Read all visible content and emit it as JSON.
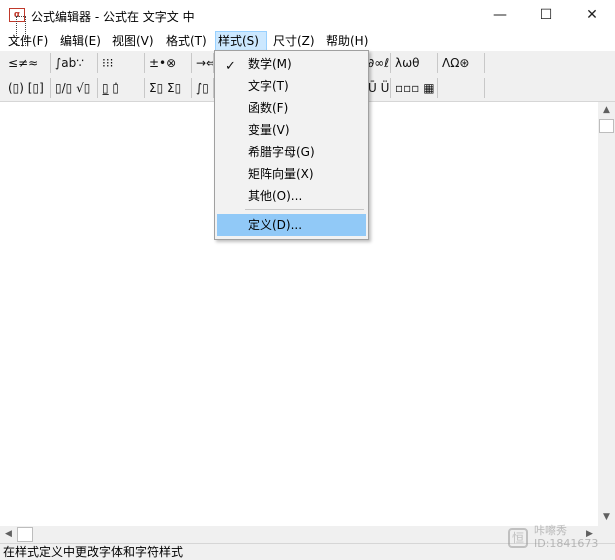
{
  "window": {
    "icon_letter": "α",
    "title": "公式编辑器 - 公式在 文字文 中",
    "controls": [
      "—",
      "☐",
      "✕"
    ]
  },
  "menubar": [
    {
      "label": "文件(F)"
    },
    {
      "label": "编辑(E)"
    },
    {
      "label": "视图(V)"
    },
    {
      "label": "格式(T)"
    },
    {
      "label": "样式(S)"
    },
    {
      "label": "尺寸(Z)"
    },
    {
      "label": "帮助(H)"
    }
  ],
  "toolbar": {
    "row1": [
      "≤≠≈",
      "∫ab∵",
      "⁝⁝⁝",
      "±•⊗",
      "→⇔↓",
      "∴∀∃",
      "∉∩⊂",
      "∂∞ℓ",
      "λωθ",
      "ΛΩ⊛"
    ],
    "row2": [
      "(▯) [▯]",
      "▯/▯ √▯",
      "▯̲ ▯̇",
      "Σ▯ Σ▯",
      "∫▯ ∮▯",
      "",
      "",
      "Ū Ü",
      "▫▫▫ ▦",
      ""
    ]
  },
  "dropdown": {
    "items": [
      {
        "label": "数学(M)",
        "checked": true
      },
      {
        "label": "文字(T)"
      },
      {
        "label": "函数(F)"
      },
      {
        "label": "变量(V)"
      },
      {
        "label": "希腊字母(G)"
      },
      {
        "label": "矩阵向量(X)"
      },
      {
        "label": "其他(O)..."
      }
    ],
    "define_item": {
      "label": "定义(D)...",
      "highlighted": true
    },
    "check_mark": "✓"
  },
  "scrollbars": {
    "up_arrow": "▲",
    "down_arrow": "▼",
    "left_arrow": "◀",
    "right_arrow": "▶"
  },
  "status": {
    "text": "在样式定义中更改字体和字符样式"
  },
  "watermark": {
    "logo": "恒",
    "name": "咔嚓秀",
    "id": "ID:1841673"
  }
}
